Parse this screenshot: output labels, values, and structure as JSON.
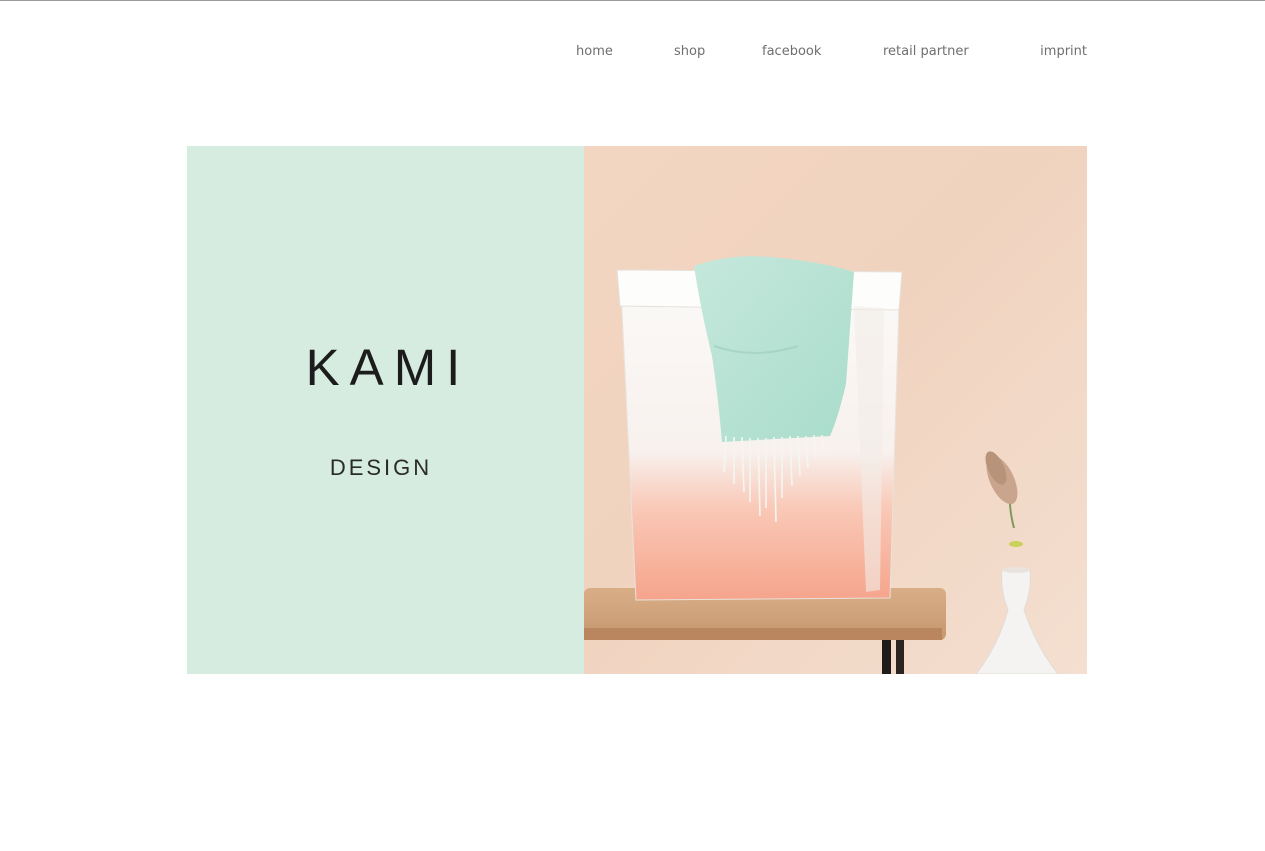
{
  "nav": {
    "items": [
      {
        "label": "home"
      },
      {
        "label": "shop"
      },
      {
        "label": "facebook"
      },
      {
        "label": "retail partner"
      },
      {
        "label": "imprint"
      }
    ]
  },
  "hero": {
    "logo": {
      "name": "KAMI",
      "tagline": "DESIGN"
    },
    "photo": {
      "alt": "paper-bag-with-scarf-on-bench"
    },
    "colors": {
      "left_panel": "#d6ece0",
      "wall": "#f1d5c1"
    }
  }
}
